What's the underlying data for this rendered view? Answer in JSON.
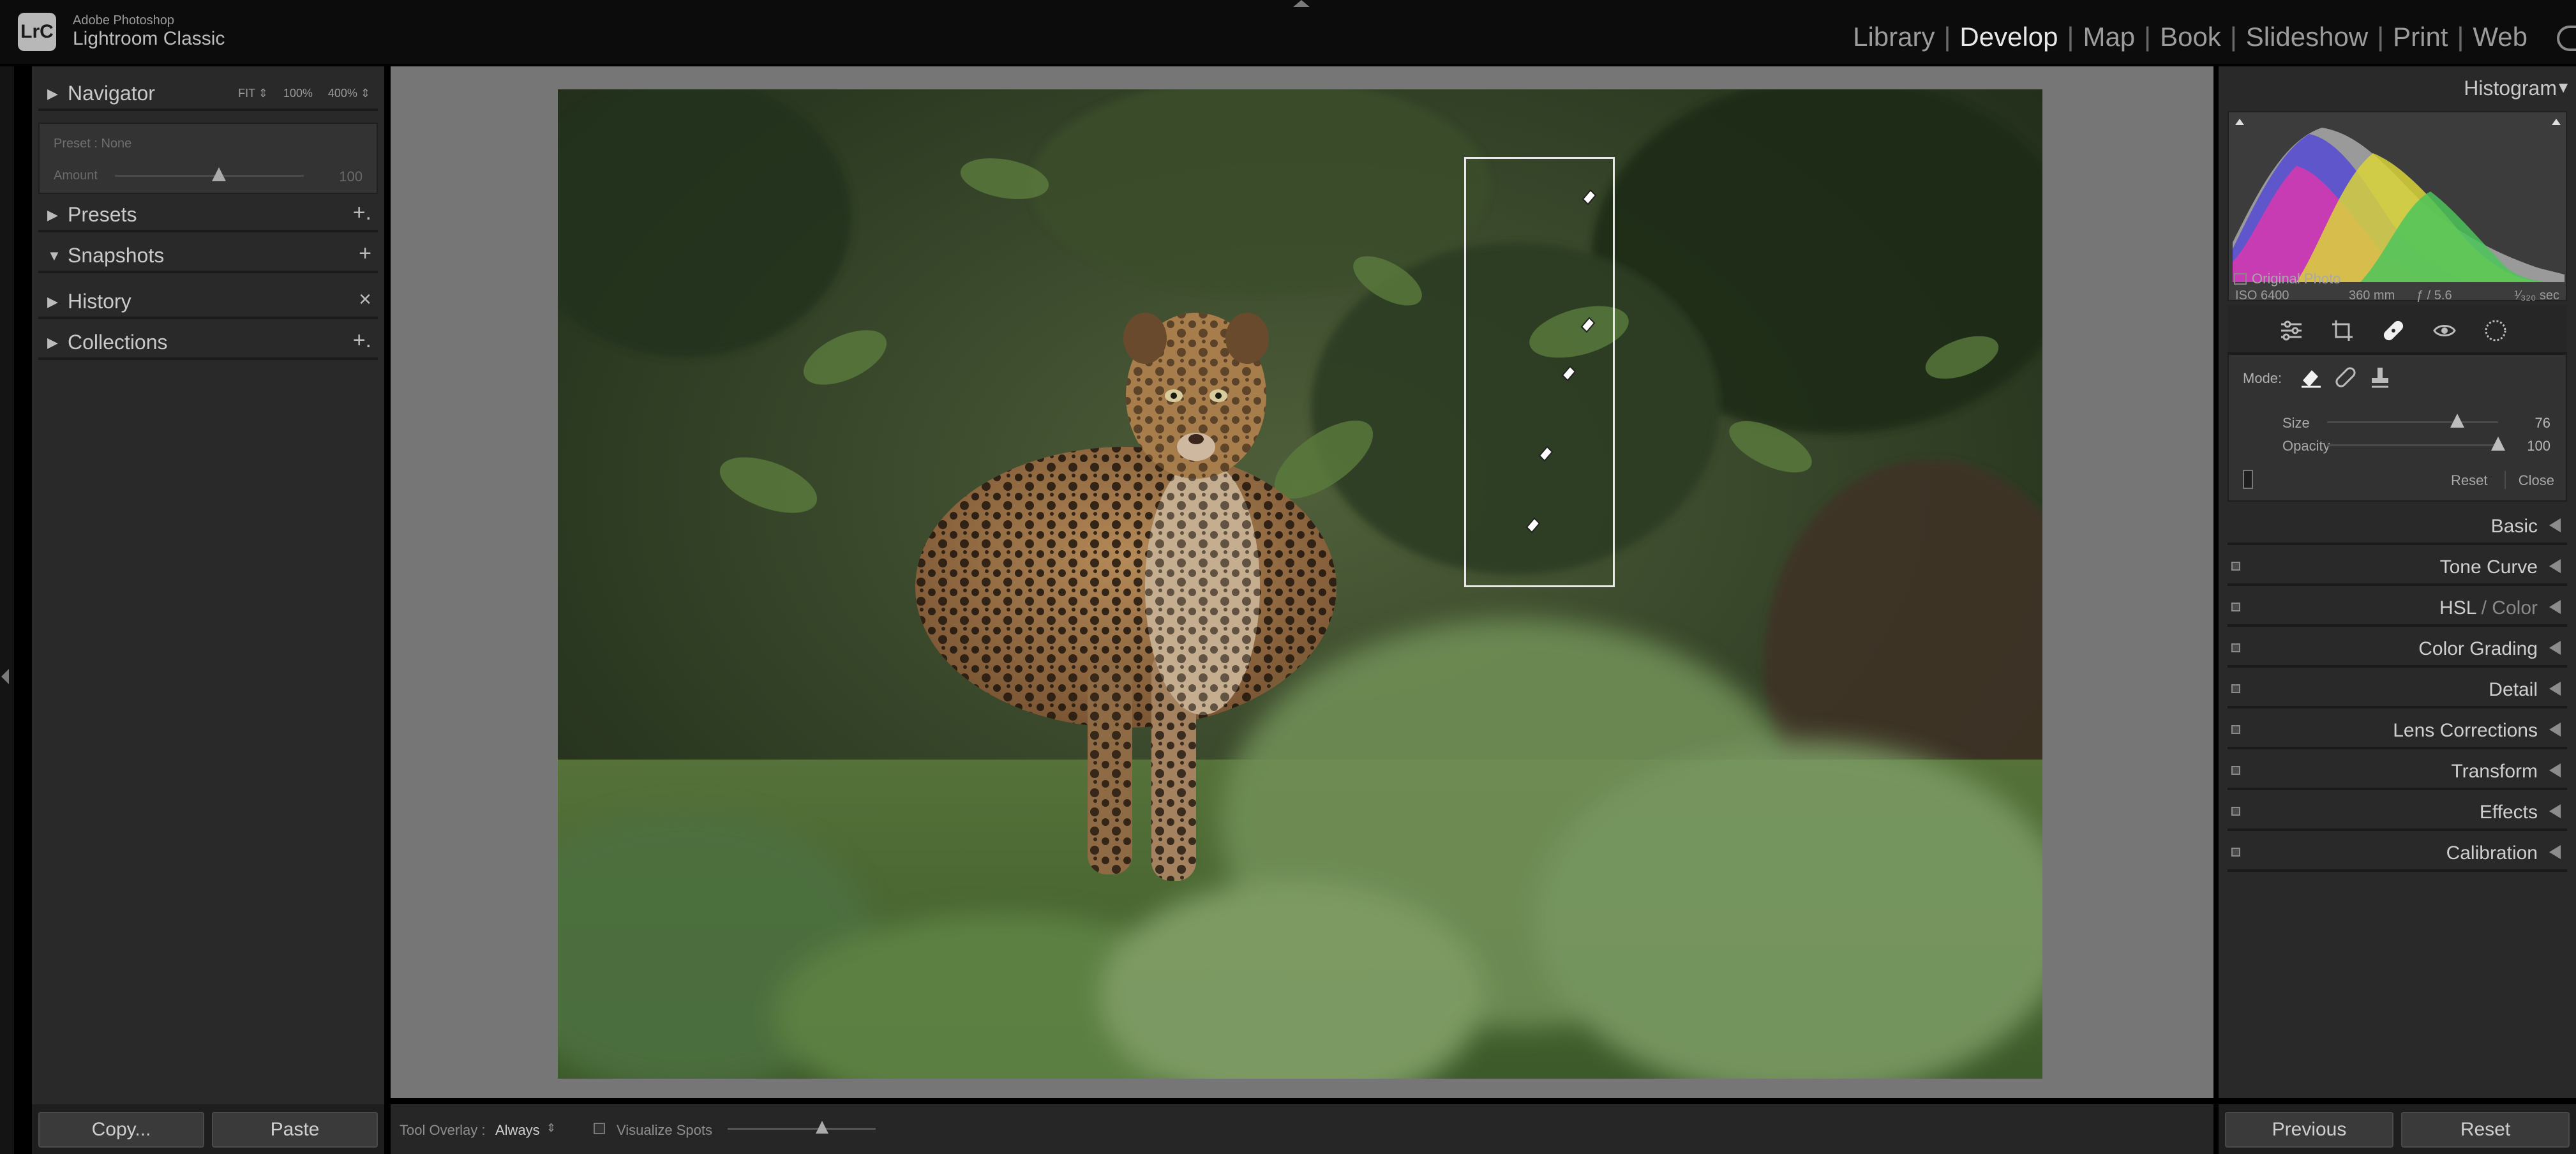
{
  "app": {
    "badge": "LrC",
    "vendor": "Adobe Photoshop",
    "product": "Lightroom Classic"
  },
  "modules": {
    "items": [
      "Library",
      "Develop",
      "Map",
      "Book",
      "Slideshow",
      "Print",
      "Web"
    ],
    "active": "Develop",
    "separator": "|"
  },
  "left_panel": {
    "navigator": {
      "label": "Navigator",
      "zoom_fit": "FIT ⇕",
      "zoom_100": "100%",
      "zoom_400": "400% ⇕"
    },
    "preset": {
      "name": "Preset : None",
      "amount_label": "Amount",
      "amount_value": "100",
      "amount_level": 0.55
    },
    "presets": {
      "label": "Presets",
      "action": "+."
    },
    "snapshots": {
      "label": "Snapshots",
      "action": "+"
    },
    "history": {
      "label": "History",
      "action": "×"
    },
    "collections": {
      "label": "Collections",
      "action": "+."
    },
    "copy_button": "Copy...",
    "paste_button": "Paste"
  },
  "toolbar": {
    "tool_overlay_label": "Tool Overlay :",
    "tool_overlay_value": "Always",
    "tool_overlay_arrow": "⇕",
    "visualize_spots_label": "Visualize Spots",
    "visualize_spots_checked": false,
    "visualize_level": 0.64
  },
  "right_panel": {
    "histogram": {
      "title": "Histogram",
      "iso": "ISO 6400",
      "focal_length": "360 mm",
      "aperture": "ƒ / 5.6",
      "shutter": "¹⁄₃₂₀ sec",
      "original_photo_label": "Original Photo"
    },
    "tools": [
      "edit-sliders-icon",
      "crop-icon",
      "healing-icon",
      "red-eye-icon",
      "masking-icon"
    ],
    "active_tool": "healing-icon",
    "healing": {
      "mode_label": "Mode:",
      "modes": [
        "content-aware-remove-icon",
        "heal-icon",
        "clone-icon"
      ],
      "active_mode": "content-aware-remove-icon",
      "size_label": "Size",
      "size_value": "76",
      "size_level": 0.76,
      "opacity_label": "Opacity",
      "opacity_value": "100",
      "opacity_level": 1.0,
      "reset_label": "Reset",
      "close_label": "Close"
    },
    "sections": [
      {
        "label": "Basic",
        "has_toggle": false
      },
      {
        "label": "Tone Curve",
        "has_toggle": true
      },
      {
        "label": "HSL",
        "label_suffix": " / Color",
        "has_toggle": true
      },
      {
        "label": "Color Grading",
        "has_toggle": true
      },
      {
        "label": "Detail",
        "has_toggle": true
      },
      {
        "label": "Lens Corrections",
        "has_toggle": true
      },
      {
        "label": "Transform",
        "has_toggle": true
      },
      {
        "label": "Effects",
        "has_toggle": true
      },
      {
        "label": "Calibration",
        "has_toggle": true
      }
    ],
    "previous_button": "Previous",
    "reset_button": "Reset"
  },
  "colors": {
    "panel_bg": "#292929",
    "canvas_bg": "#767676",
    "active_text": "#e8e8e8"
  }
}
